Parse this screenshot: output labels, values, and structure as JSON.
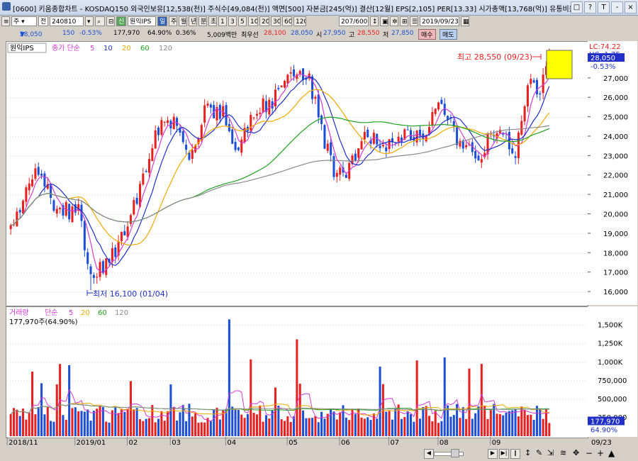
{
  "window": {
    "title": "[0600] 키움종합차트 - KOSDAQ150 외국인보유[12,538(천)] 주식수[49,084(천)] 액면[500] 자본금[245(억)] 결산[12월] EPS[2,105] PER[13.33] 시가총액[13,768(억)] 유통비율[67",
    "buttons": [
      "□",
      "?",
      "T",
      "‐",
      "×"
    ]
  },
  "toolbar": {
    "market": "주",
    "scope": "전",
    "code": "240810",
    "search_icon": "search-icon",
    "name": "원익IPS",
    "day_btn": "일",
    "periods": [
      "주",
      "월",
      "년",
      "분",
      "초",
      "1",
      "3",
      "5",
      "10",
      "20",
      "30",
      "60",
      "120"
    ],
    "count": "207",
    "count_total": "600",
    "date": "2019/09/23"
  },
  "quote": {
    "price": "28,050",
    "arrow": "▼",
    "change": "150",
    "change_pct": "-0.53%",
    "volume": "177,970",
    "vol_ratio": "64.90%",
    "turnover": "0.36%",
    "amount": "5,009백만",
    "bid_label": "최우선",
    "bid1": "28,100",
    "bid2": "28,050",
    "open_label": "시",
    "open": "27,950",
    "high_label": "고",
    "high": "28,550",
    "low_label": "저",
    "low": "27,850",
    "buy": "매수",
    "sell": "매도"
  },
  "price_panel": {
    "label": "원익IPS",
    "legend_prefix": "종가 단순",
    "ma_labels": [
      "5",
      "10",
      "20",
      "60",
      "120"
    ],
    "lc": "LC:74.22",
    "hc": "HC:-1.75",
    "last": "28,050",
    "last_pct": "-0.53%",
    "high_note": "최고 28,550 (09/23)",
    "low_note": "최저 16,100 (01/04)"
  },
  "volume_panel": {
    "label": "거래량",
    "legend_prefix": "단순",
    "ma_labels": [
      "5",
      "20",
      "60",
      "120"
    ],
    "current": "177,970주(64.90%)",
    "last": "177,970",
    "last_pct": "64.90%"
  },
  "colors": {
    "up": "#e8201f",
    "down": "#1d4fd6",
    "ma5": "#d23ad2",
    "ma10": "#2030c8",
    "ma20": "#f0a800",
    "ma60": "#1fa21f",
    "ma120": "#8a8a8a"
  },
  "chart_data": {
    "type": "candlestick",
    "x_labels": [
      "2018/11",
      "2019/01",
      "02",
      "03",
      "04",
      "05",
      "06",
      "07",
      "08",
      "09",
      "09/23"
    ],
    "price_ticks": [
      16000,
      17000,
      18000,
      19000,
      20000,
      21000,
      22000,
      23000,
      24000,
      25000,
      26000,
      27000
    ],
    "price_ylim": [
      15600,
      28600
    ],
    "volume_ticks": [
      "250,000",
      "500,000",
      "750,000",
      "1,000K",
      "1,250K",
      "1,500K"
    ],
    "volume_ylim": [
      0,
      1650000
    ],
    "anchors": [
      {
        "i": 0,
        "p": 19300
      },
      {
        "i": 8,
        "p": 22500
      },
      {
        "i": 15,
        "p": 20300
      },
      {
        "i": 22,
        "p": 20100
      },
      {
        "i": 26,
        "p": 17000
      },
      {
        "i": 32,
        "p": 17600
      },
      {
        "i": 38,
        "p": 19500
      },
      {
        "i": 44,
        "p": 22500
      },
      {
        "i": 48,
        "p": 24500
      },
      {
        "i": 53,
        "p": 24600
      },
      {
        "i": 58,
        "p": 22600
      },
      {
        "i": 63,
        "p": 25400
      },
      {
        "i": 69,
        "p": 25200
      },
      {
        "i": 74,
        "p": 23300
      },
      {
        "i": 79,
        "p": 25300
      },
      {
        "i": 86,
        "p": 26000
      },
      {
        "i": 93,
        "p": 27600
      },
      {
        "i": 97,
        "p": 27000
      },
      {
        "i": 102,
        "p": 23800
      },
      {
        "i": 106,
        "p": 21800
      },
      {
        "i": 110,
        "p": 22500
      },
      {
        "i": 116,
        "p": 24100
      },
      {
        "i": 122,
        "p": 23300
      },
      {
        "i": 128,
        "p": 24300
      },
      {
        "i": 134,
        "p": 23900
      },
      {
        "i": 140,
        "p": 25800
      },
      {
        "i": 146,
        "p": 23600
      },
      {
        "i": 152,
        "p": 23000
      },
      {
        "i": 158,
        "p": 24400
      },
      {
        "i": 164,
        "p": 23000
      },
      {
        "i": 168,
        "p": 27000
      },
      {
        "i": 172,
        "p": 26500
      },
      {
        "i": 175,
        "p": 28050
      }
    ],
    "series": [
      {
        "name": "5",
        "color": "#d23ad2"
      },
      {
        "name": "10",
        "color": "#2030c8"
      },
      {
        "name": "20",
        "color": "#f0a800"
      },
      {
        "name": "60",
        "color": "#1fa21f"
      },
      {
        "name": "120",
        "color": "#8a8a8a"
      }
    ],
    "candles": 176,
    "high": {
      "value": 28550,
      "date": "09/23"
    },
    "low": {
      "value": 16100,
      "date": "01/04"
    }
  }
}
